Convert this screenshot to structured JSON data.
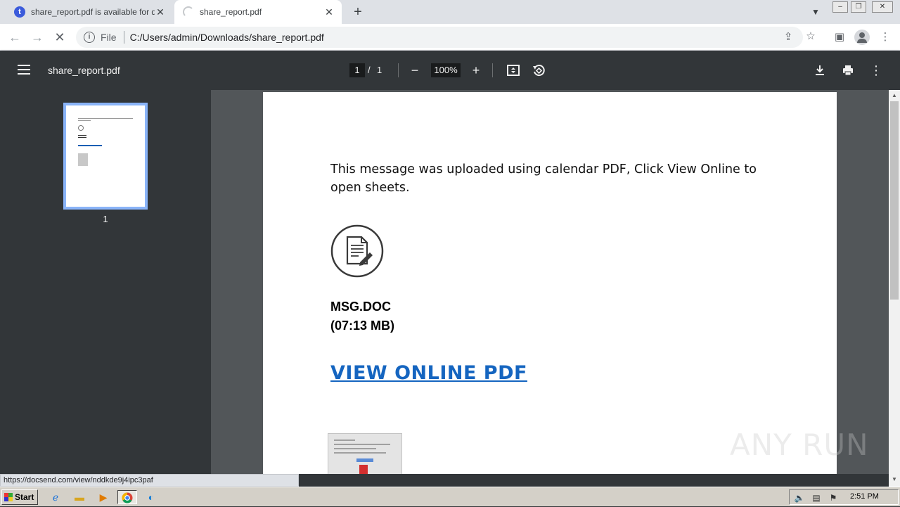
{
  "browser": {
    "tabs": [
      {
        "title": "share_report.pdf is available for dow",
        "icon": "document-favicon-icon",
        "favicon_glyph": "t",
        "active": false
      },
      {
        "title": "share_report.pdf",
        "icon": "loading-spinner-icon",
        "active": true
      }
    ],
    "address": {
      "scheme_label": "File",
      "url": "C:/Users/admin/Downloads/share_report.pdf"
    }
  },
  "pdf_toolbar": {
    "filename": "share_report.pdf",
    "current_page": "1",
    "page_separator": "/",
    "total_pages": "1",
    "zoom": "100%"
  },
  "sidebar": {
    "thumbnails": [
      {
        "label": "1"
      }
    ]
  },
  "document": {
    "message": "This message was uploaded using calendar PDF, Click View Online to open sheets.",
    "file_name": "MSG.DOC",
    "file_size": "(07:13 MB)",
    "link_text": "VIEW ONLINE PDF"
  },
  "status_bar": {
    "hover_url": "https://docsend.com/view/nddkde9j4ipc3paf"
  },
  "watermark": {
    "text": "ANY RUN"
  },
  "taskbar": {
    "start_label": "Start",
    "clock": "2:51 PM"
  },
  "colors": {
    "pdf_toolbar_bg": "#323639",
    "viewer_bg": "#525659",
    "link": "#1565c0",
    "thumbnail_highlight": "#8ab4f8"
  }
}
